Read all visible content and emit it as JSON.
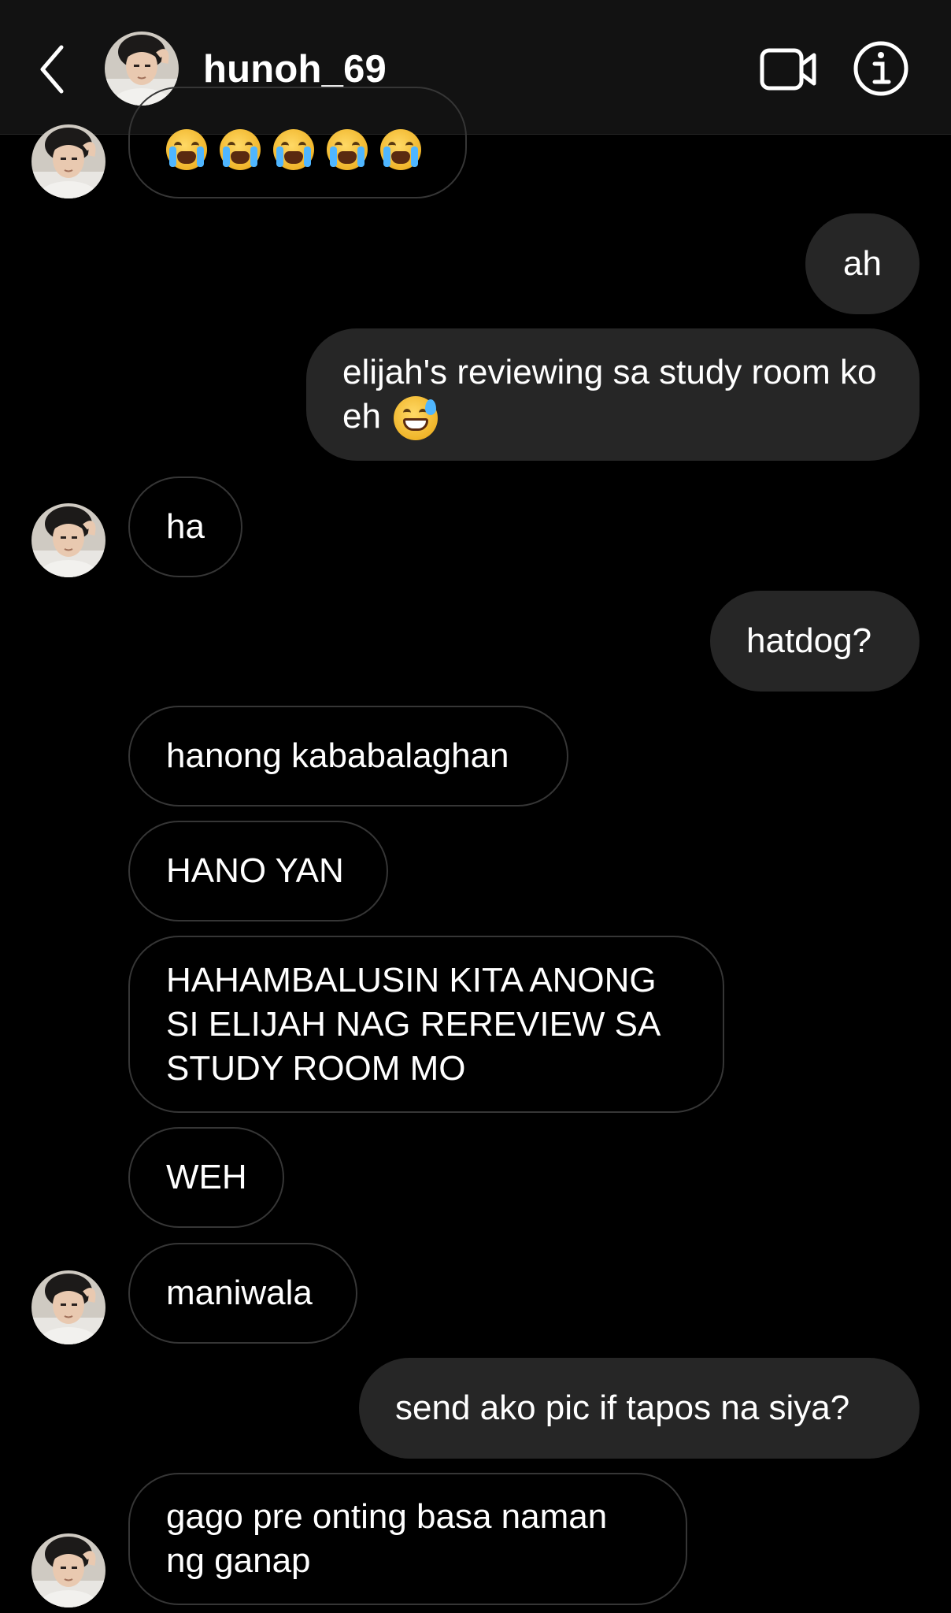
{
  "header": {
    "username": "hunoh_69",
    "icons": {
      "back": "chevron-left-icon",
      "video": "video-camera-icon",
      "info": "info-icon"
    }
  },
  "colors": {
    "background": "#000000",
    "header": "#121212",
    "sent_bubble": "#262626",
    "received_border": "#363636"
  },
  "messages": [
    {
      "from": "them",
      "emoji": "loudly-crying-face x5"
    },
    {
      "from": "me",
      "text": "ah"
    },
    {
      "from": "me",
      "text": "elijah's reviewing sa study room ko eh",
      "emoji": "grinning-face-with-sweat"
    },
    {
      "from": "them",
      "text": "ha"
    },
    {
      "from": "me",
      "text": "hatdog?"
    },
    {
      "from": "them",
      "text": "hanong kababalaghan"
    },
    {
      "from": "them",
      "text": "HANO YAN"
    },
    {
      "from": "them",
      "line1": "HAHAMBALUSIN KITA ANONG",
      "line2": "SI ELIJAH NAG REREVIEW SA",
      "line3": "STUDY ROOM MO"
    },
    {
      "from": "them",
      "text": "WEH"
    },
    {
      "from": "them",
      "text": "maniwala"
    },
    {
      "from": "me",
      "text": "send ako pic if tapos na siya?"
    },
    {
      "from": "them",
      "line1": "gago pre onting basa naman",
      "line2": "ng ganap"
    }
  ]
}
